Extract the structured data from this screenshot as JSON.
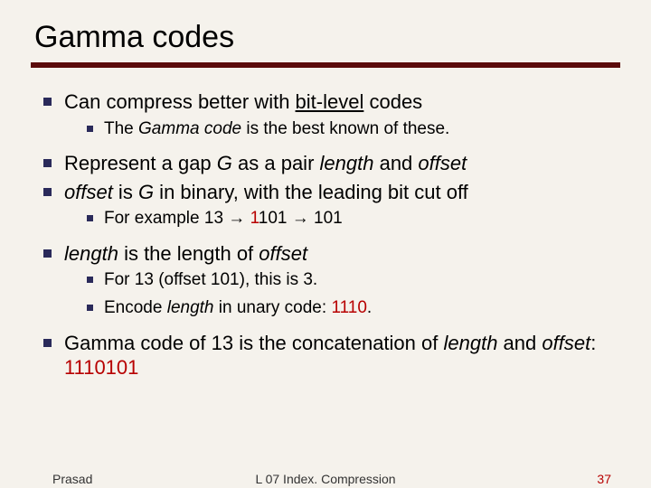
{
  "title": "Gamma codes",
  "b1a": "Can compress better with ",
  "b1b": "bit-level",
  "b1c": " codes",
  "b1_1a": "The ",
  "b1_1b": "Gamma code",
  "b1_1c": " is the best known of these.",
  "b2a": "Represent a gap ",
  "b2b": "G",
  "b2c": " as a pair ",
  "b2d": "length",
  "b2e": " and ",
  "b2f": "offset",
  "b3a": "offset",
  "b3b": " is ",
  "b3c": "G",
  "b3d": " in binary, with the leading bit cut off",
  "b3_1a": "For example 13 → ",
  "b3_1b": "1",
  "b3_1c": "101 → 101",
  "b4a": "length",
  "b4b": " is the length of ",
  "b4c": "offset",
  "b4_1": "For 13 (offset 101), this is 3.",
  "b4_2a": "Encode ",
  "b4_2b": "length",
  "b4_2c": " in unary code: ",
  "b4_2d": "1110",
  "b4_2e": ".",
  "b5a": "Gamma code of 13 is the concatenation of ",
  "b5b": "length",
  "b5c": " and ",
  "b5d": "offset",
  "b5e": ": ",
  "b5f": "1110101",
  "footer_left": "Prasad",
  "footer_center": "L 07 Index. Compression",
  "footer_right": "37"
}
